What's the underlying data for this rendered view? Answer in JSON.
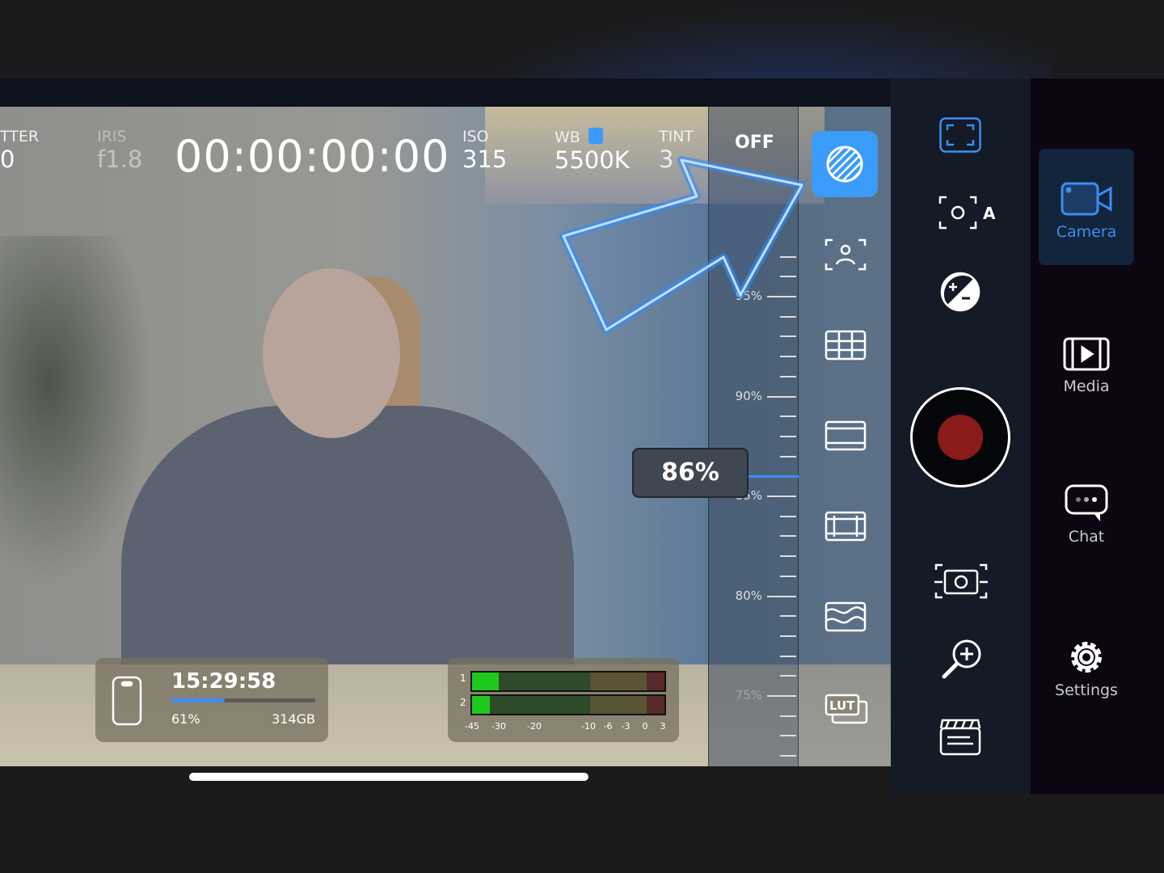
{
  "hud": {
    "shutter_label": "TTER",
    "shutter_value": "0",
    "iris_label": "IRIS",
    "iris_value": "f1.8",
    "timecode": "00:00:00:00",
    "iso_label": "ISO",
    "iso_value": "315",
    "wb_label": "WB",
    "wb_value": "5500K",
    "tint_label": "TINT",
    "tint_value": "3",
    "zebra_state": "OFF"
  },
  "zebra": {
    "level": "86%",
    "level_value": 86,
    "ruler_labels": [
      "95%",
      "90%",
      "85%",
      "80%",
      "75%"
    ]
  },
  "storage": {
    "time_remaining": "15:29:58",
    "percent": "61%",
    "fill_percent": 37,
    "capacity": "314GB"
  },
  "audio": {
    "channels": [
      "1",
      "2"
    ],
    "levels_db": [
      -30,
      -35
    ],
    "scale": [
      "-45",
      "-30",
      "-20",
      "-10",
      "-6",
      "-3",
      "0",
      "3"
    ]
  },
  "tools": [
    "zebra",
    "face-detect",
    "grid",
    "frame-guide",
    "aspect-crop",
    "false-color",
    "lut"
  ],
  "controls": [
    "focus-frame",
    "auto-focus",
    "exposure-compensation",
    "record",
    "capture-still",
    "zoom",
    "clapper"
  ],
  "nav": {
    "items": [
      {
        "label": "Camera",
        "active": true
      },
      {
        "label": "Media"
      },
      {
        "label": "Chat"
      },
      {
        "label": "Settings"
      }
    ]
  },
  "colors": {
    "accent": "#3a9cf8",
    "record": "#8b1a1a",
    "arrow": "#2f8cff"
  }
}
